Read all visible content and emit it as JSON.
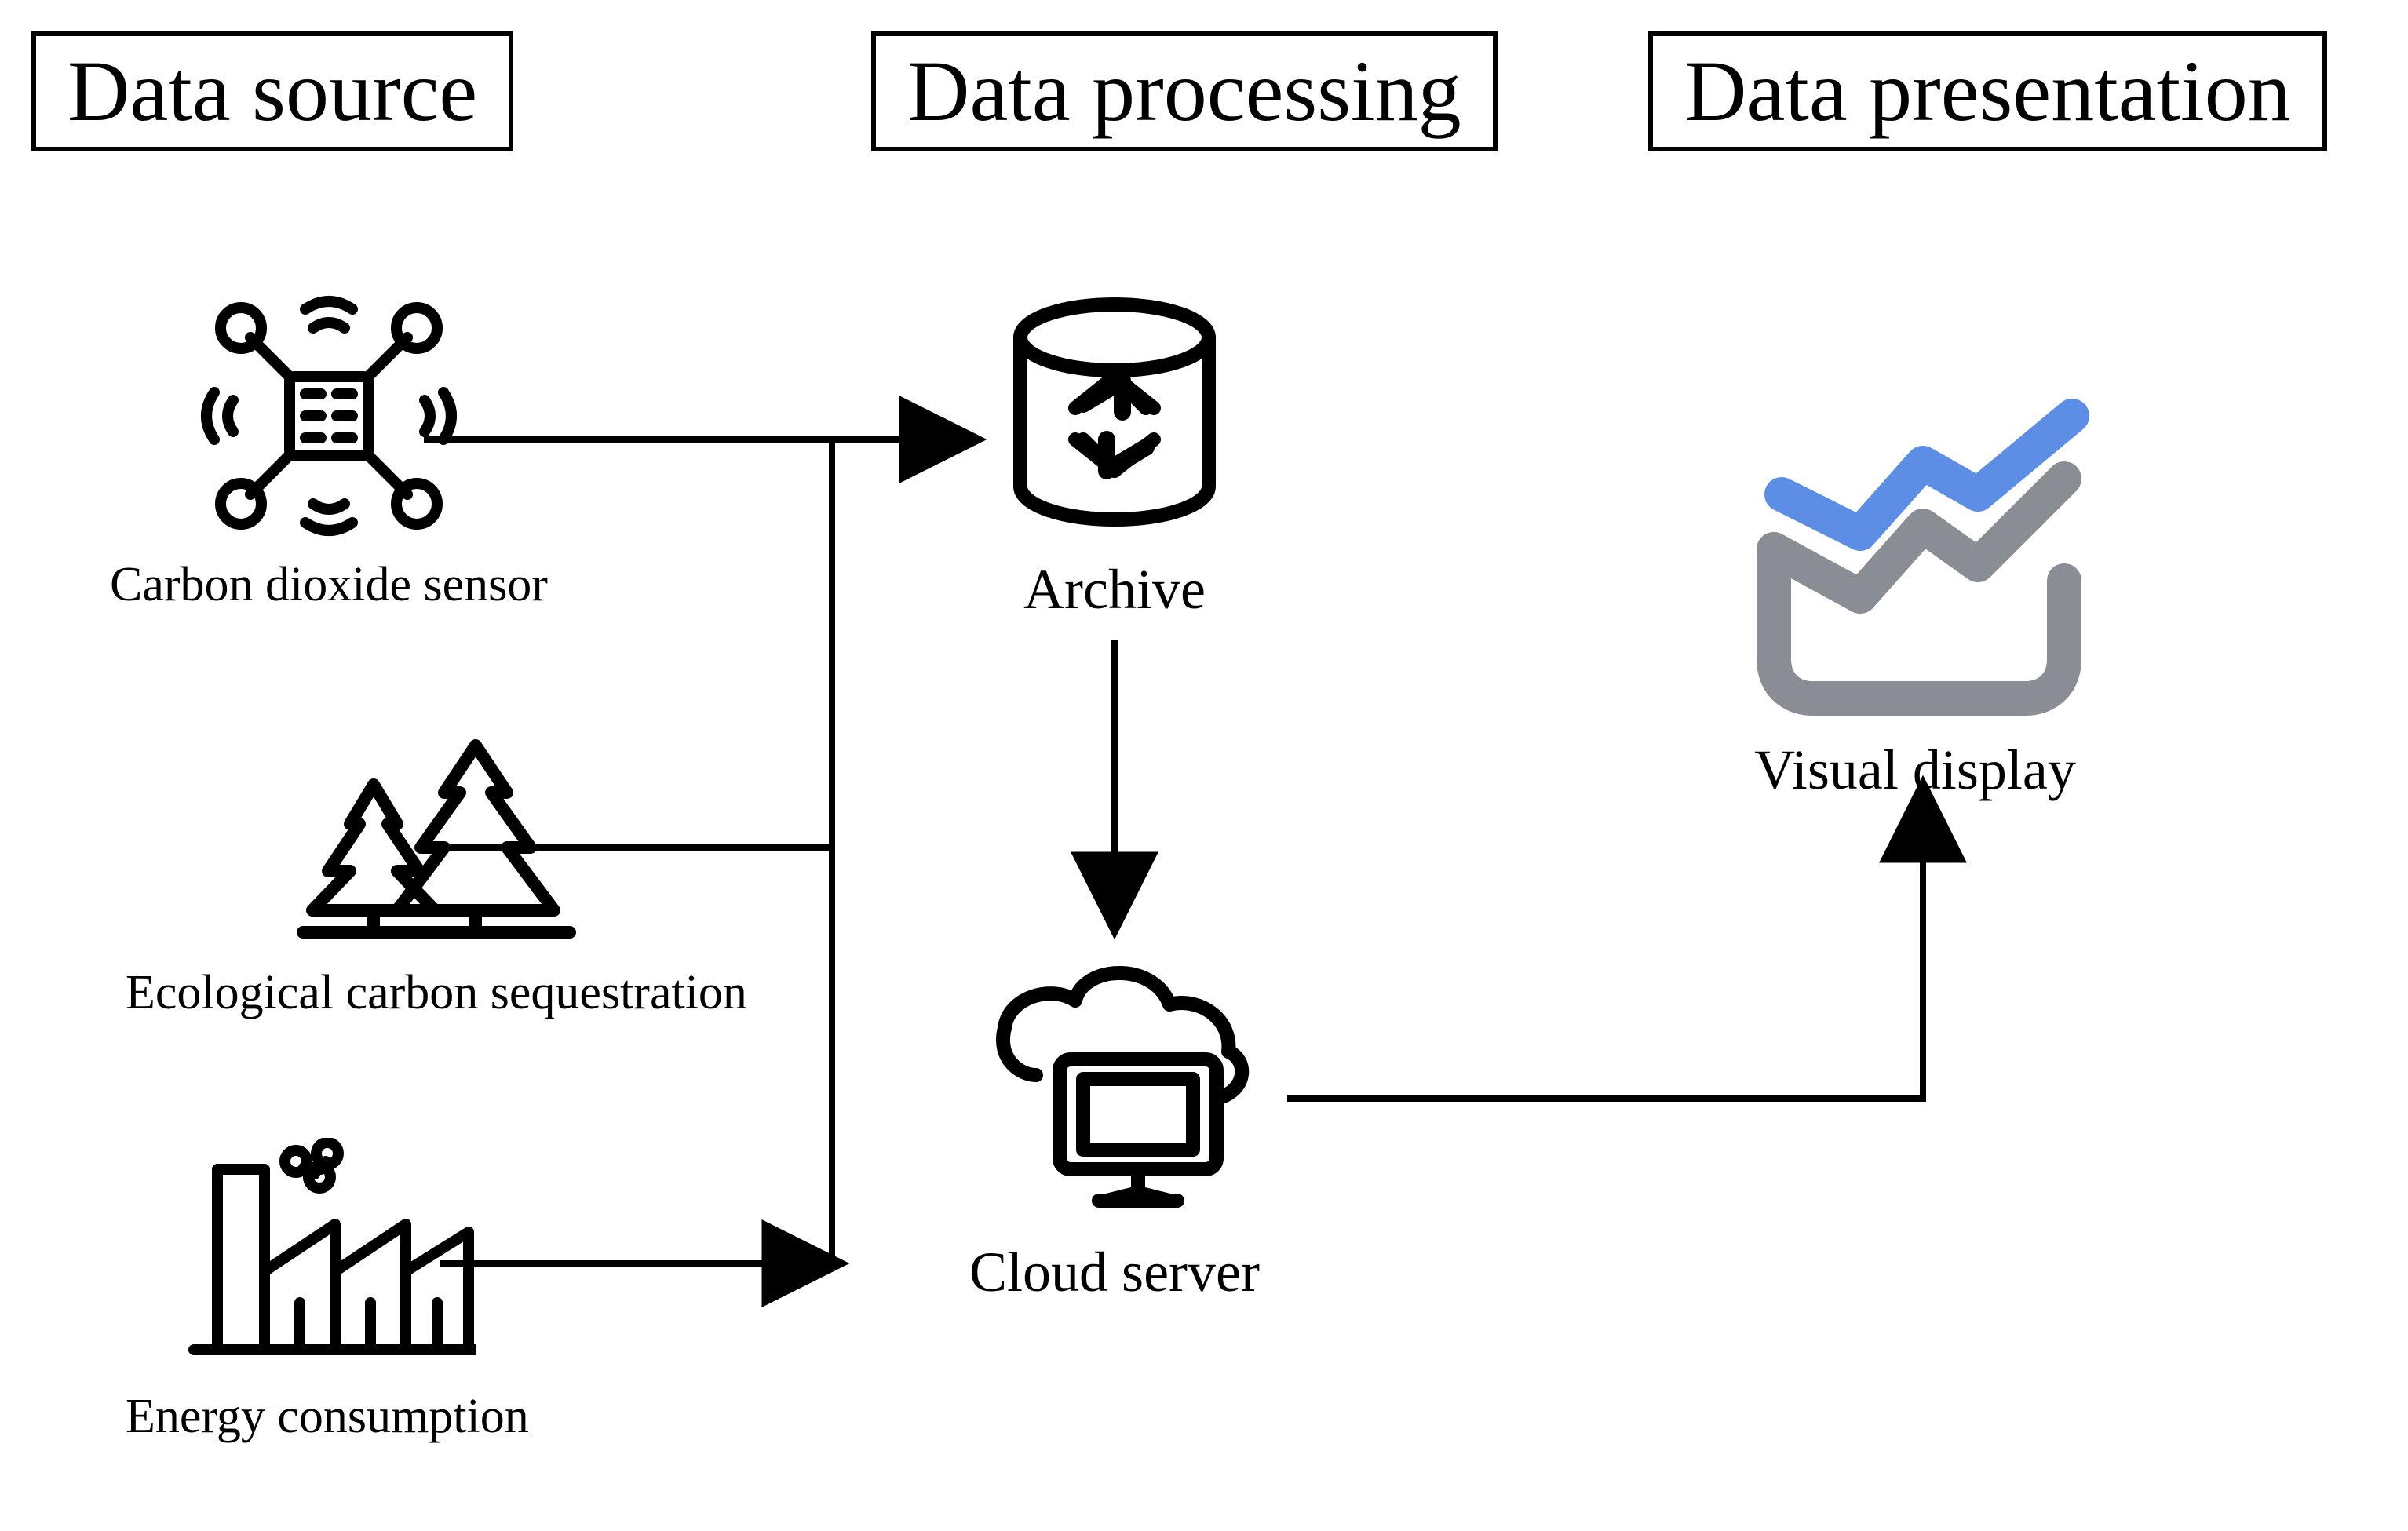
{
  "headers": {
    "left": "Data source",
    "middle": "Data processing",
    "right": "Data presentation"
  },
  "source_nodes": {
    "sensor": {
      "label": "Carbon dioxide sensor"
    },
    "trees": {
      "label": "Ecological carbon sequestration"
    },
    "factory": {
      "label": "Energy consumption"
    }
  },
  "processing_nodes": {
    "archive": {
      "label": "Archive"
    },
    "cloud": {
      "label": "Cloud server"
    }
  },
  "presentation_node": {
    "label": "Visual display"
  },
  "diagram_flow": {
    "description": "Three data sources (CO2 sensor, ecological carbon sequestration, energy consumption) feed into an Archive and a Cloud server (Data processing). Archive flows down into Cloud server. Cloud server outputs to Visual display (Data presentation)."
  }
}
